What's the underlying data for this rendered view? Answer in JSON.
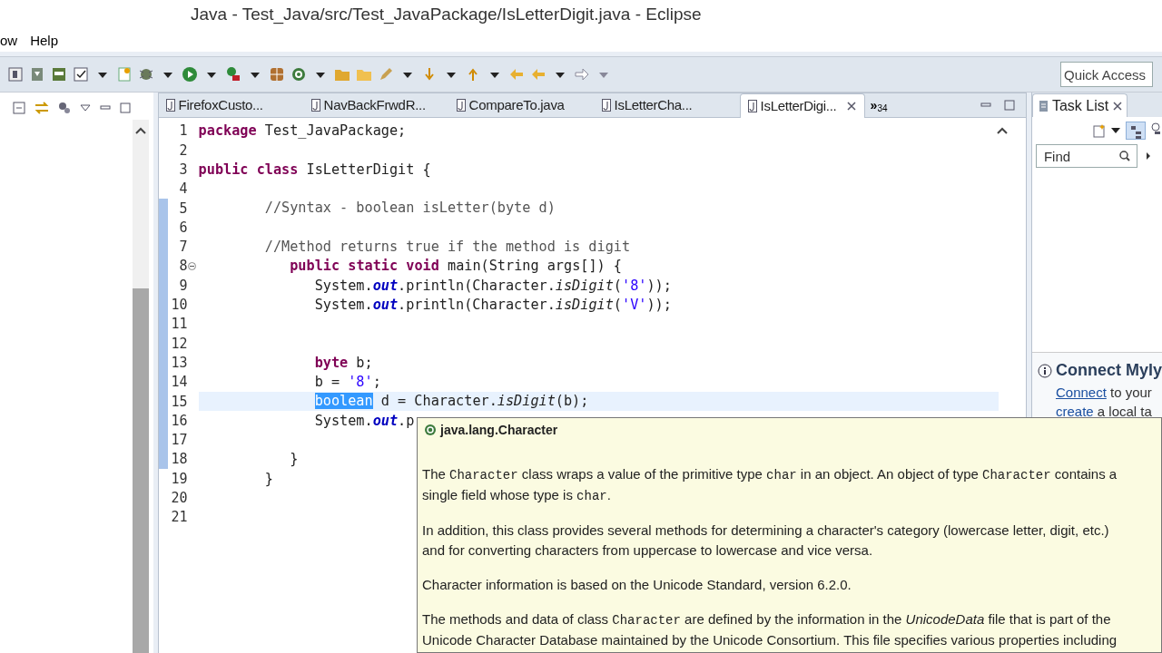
{
  "window": {
    "title": "Java - Test_Java/src/Test_JavaPackage/IsLetterDigit.java - Eclipse"
  },
  "menu": [
    "ow",
    "Help"
  ],
  "quick_access": {
    "placeholder": "Quick Access"
  },
  "editor_tabs": [
    {
      "label": "FirefoxCusto...",
      "selected": false
    },
    {
      "label": "NavBackFrwdR...",
      "selected": false
    },
    {
      "label": "CompareTo.java",
      "selected": false
    },
    {
      "label": "IsLetterCha...",
      "selected": false
    },
    {
      "label": "IsLetterDigi...",
      "selected": true
    }
  ],
  "hidden_tabs": {
    "chevron": "»",
    "count": "34"
  },
  "code_lines": [
    {
      "number": "1",
      "changed": false,
      "current": false,
      "foldable": false,
      "tokens": [
        {
          "kind": "keyword",
          "text": "package"
        },
        {
          "kind": "plain",
          "text": " Test_JavaPackage;"
        }
      ]
    },
    {
      "number": "2",
      "changed": false,
      "current": false,
      "foldable": false
    },
    {
      "number": "3",
      "changed": false,
      "current": false,
      "foldable": false,
      "tokens": [
        {
          "kind": "keyword",
          "text": "public"
        },
        {
          "kind": "keyword",
          "text": " class"
        },
        {
          "kind": "plain",
          "text": " IsLetterDigit {"
        }
      ]
    },
    {
      "number": "4",
      "changed": false,
      "current": false,
      "foldable": false
    },
    {
      "number": "5",
      "changed": true,
      "current": false,
      "foldable": false,
      "tokens": [
        {
          "kind": "comment",
          "text": "        //Syntax - boolean isLetter(byte d)"
        }
      ]
    },
    {
      "number": "6",
      "changed": true,
      "current": false,
      "foldable": false
    },
    {
      "number": "7",
      "changed": true,
      "current": false,
      "foldable": false,
      "tokens": [
        {
          "kind": "comment",
          "text": "        //Method returns true if the method is digit"
        }
      ]
    },
    {
      "number": "8",
      "changed": true,
      "current": false,
      "foldable": true,
      "tokens": [
        {
          "kind": "keyword",
          "text": "           public"
        },
        {
          "kind": "keyword",
          "text": " static"
        },
        {
          "kind": "keyword",
          "text": " void"
        },
        {
          "kind": "plain",
          "text": " main(String args[]) {"
        }
      ]
    },
    {
      "number": "9",
      "changed": true,
      "current": false,
      "foldable": false,
      "tokens": [
        {
          "kind": "plain",
          "text": "              System."
        },
        {
          "kind": "field",
          "text": "out"
        },
        {
          "kind": "plain",
          "text": ".println(Character."
        },
        {
          "kind": "method",
          "text": "isDigit"
        },
        {
          "kind": "plain",
          "text": "("
        },
        {
          "kind": "string",
          "text": "'8'"
        },
        {
          "kind": "plain",
          "text": "));"
        }
      ]
    },
    {
      "number": "10",
      "changed": true,
      "current": false,
      "foldable": false,
      "tokens": [
        {
          "kind": "plain",
          "text": "              System."
        },
        {
          "kind": "field",
          "text": "out"
        },
        {
          "kind": "plain",
          "text": ".println(Character."
        },
        {
          "kind": "method",
          "text": "isDigit"
        },
        {
          "kind": "plain",
          "text": "("
        },
        {
          "kind": "string",
          "text": "'V'"
        },
        {
          "kind": "plain",
          "text": "));"
        }
      ]
    },
    {
      "number": "11",
      "changed": true,
      "current": false,
      "foldable": false
    },
    {
      "number": "12",
      "changed": true,
      "current": false,
      "foldable": false
    },
    {
      "number": "13",
      "changed": true,
      "current": false,
      "foldable": false,
      "tokens": [
        {
          "kind": "keyword",
          "text": "              byte"
        },
        {
          "kind": "plain",
          "text": " b;"
        }
      ]
    },
    {
      "number": "14",
      "changed": true,
      "current": false,
      "foldable": false,
      "tokens": [
        {
          "kind": "plain",
          "text": "              b = "
        },
        {
          "kind": "string",
          "text": "'8'"
        },
        {
          "kind": "plain",
          "text": ";"
        }
      ]
    },
    {
      "number": "15",
      "changed": true,
      "current": true,
      "foldable": false,
      "tokens": [
        {
          "kind": "selection",
          "text": "              boolean"
        },
        {
          "kind": "plain",
          "text": " d = Character."
        },
        {
          "kind": "method",
          "text": "isDigit"
        },
        {
          "kind": "plain",
          "text": "(b);"
        }
      ]
    },
    {
      "number": "16",
      "changed": true,
      "current": false,
      "foldable": false,
      "tokens": [
        {
          "kind": "plain",
          "text": "              System."
        },
        {
          "kind": "field",
          "text": "out"
        },
        {
          "kind": "plain",
          "text": ".p"
        }
      ]
    },
    {
      "number": "17",
      "changed": true,
      "current": false,
      "foldable": false
    },
    {
      "number": "18",
      "changed": true,
      "current": false,
      "foldable": false,
      "tokens": [
        {
          "kind": "plain",
          "text": "           }"
        }
      ]
    },
    {
      "number": "19",
      "changed": false,
      "current": false,
      "foldable": false,
      "tokens": [
        {
          "kind": "plain",
          "text": "        }"
        }
      ]
    },
    {
      "number": "20",
      "changed": false,
      "current": false,
      "foldable": false
    },
    {
      "number": "21",
      "changed": false,
      "current": false,
      "foldable": false
    }
  ],
  "tooltip": {
    "title": "java.lang.Character",
    "paragraphs": [
      [
        {
          "kind": "text",
          "text": "The "
        },
        {
          "kind": "code",
          "text": "Character"
        },
        {
          "kind": "text",
          "text": " class wraps a value of the primitive type "
        },
        {
          "kind": "code",
          "text": "char"
        },
        {
          "kind": "text",
          "text": " in an object. An object of type "
        },
        {
          "kind": "code",
          "text": "Character"
        },
        {
          "kind": "text",
          "text": " contains a single field whose type is "
        },
        {
          "kind": "code",
          "text": "char"
        },
        {
          "kind": "text",
          "text": "."
        }
      ],
      [
        {
          "kind": "text",
          "text": "In addition, this class provides several methods for determining a character's category (lowercase letter, digit, etc.) and for converting characters from uppercase to lowercase and vice versa."
        }
      ],
      [
        {
          "kind": "text",
          "text": "Character information is based on the Unicode Standard, version 6.2.0."
        }
      ],
      [
        {
          "kind": "text",
          "text": "The methods and data of class "
        },
        {
          "kind": "code",
          "text": "Character"
        },
        {
          "kind": "text",
          "text": " are defined by the information in the "
        },
        {
          "kind": "italic",
          "text": "UnicodeData"
        },
        {
          "kind": "text",
          "text": " file that is part of the Unicode Character Database maintained by the Unicode Consortium. This file specifies various properties including"
        }
      ]
    ]
  },
  "task_list": {
    "tab": "Task List",
    "find": {
      "placeholder": "Find"
    },
    "mylyn": {
      "title": "Connect Myly",
      "lines": [
        [
          {
            "kind": "link",
            "text": "Connect"
          },
          {
            "kind": "text",
            "text": " to your"
          }
        ],
        [
          {
            "kind": "link",
            "text": "create"
          },
          {
            "kind": "text",
            "text": " a local ta"
          }
        ]
      ]
    }
  }
}
